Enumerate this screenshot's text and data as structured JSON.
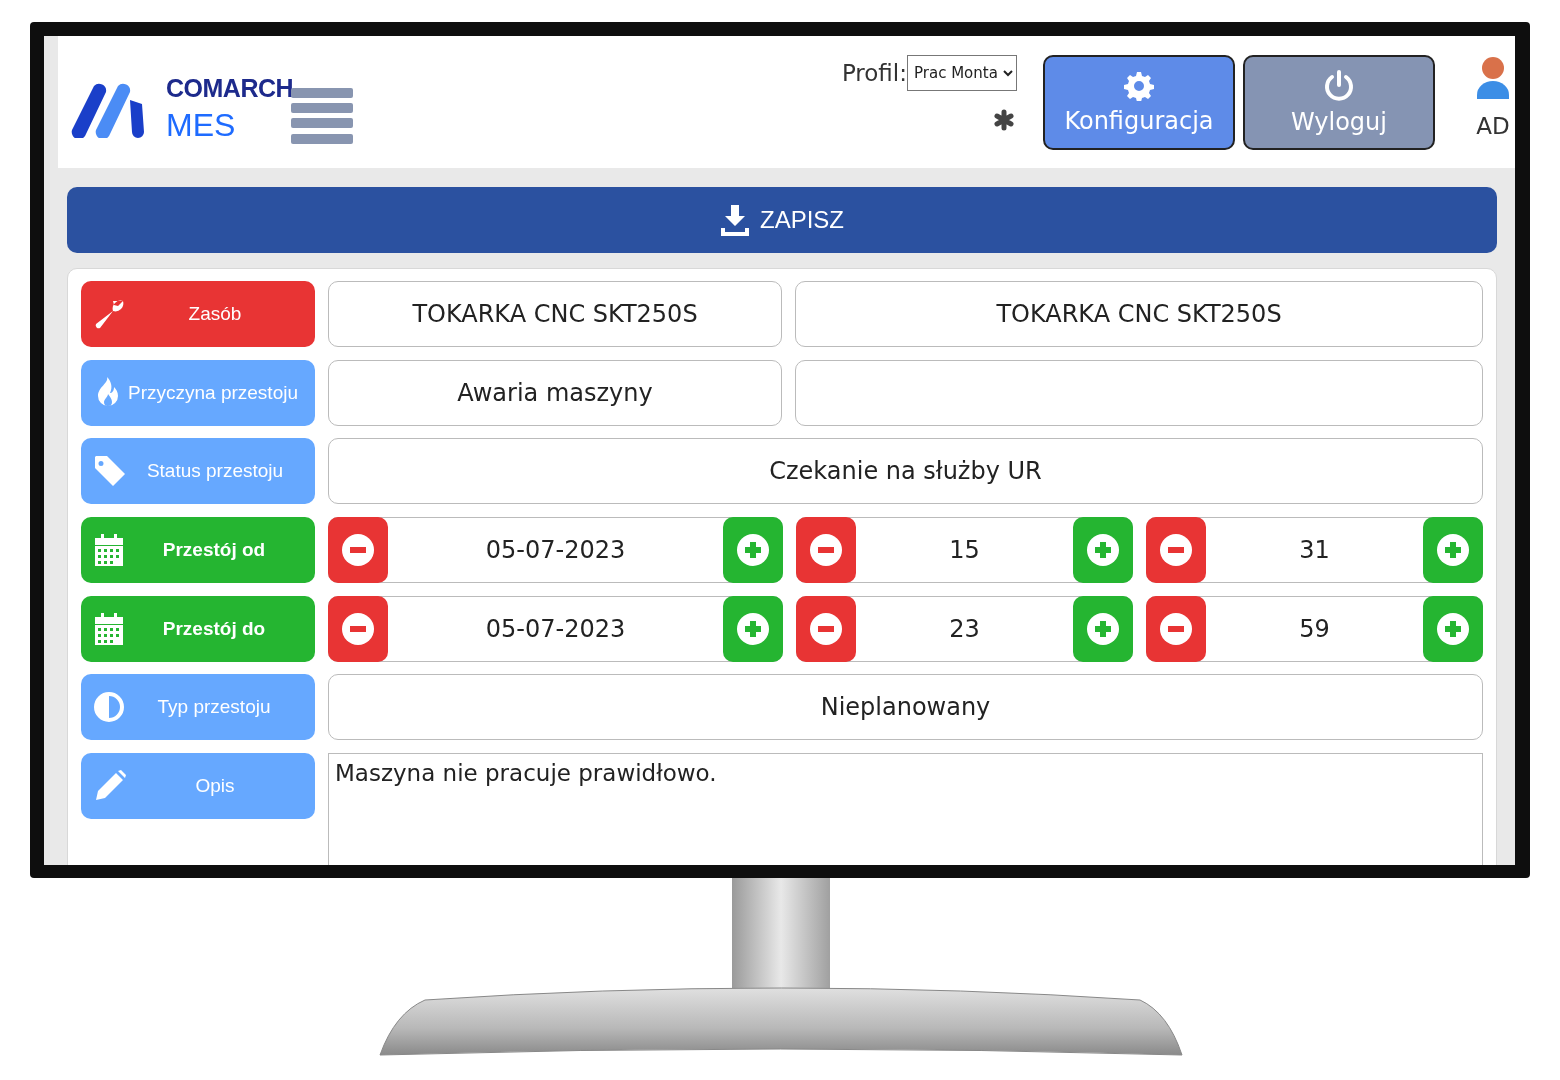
{
  "header": {
    "logo": {
      "line_1": "COMARCH",
      "line_2": "MES"
    },
    "profile_label": "Profil:",
    "profile_select": "Prac Monta",
    "buttons": [
      {
        "label": "Konfiguracja",
        "kind": "config"
      },
      {
        "label": "Wyloguj",
        "kind": "logout"
      }
    ],
    "user": "AD"
  },
  "save_button": "ZAPISZ",
  "rows": [
    {
      "kind": "pair",
      "label": "Zasób",
      "color": "#e83434",
      "values": [
        "TOKARKA CNC SKT250S",
        "TOKARKA CNC SKT250S"
      ]
    },
    {
      "kind": "pair",
      "label": "Przyczyna przestoju",
      "color": "#66a8ff",
      "values": [
        "Awaria maszyny"
      ]
    },
    {
      "kind": "single",
      "label": "Status przestoju",
      "color": "#66a8ff",
      "value": "Czekanie na służby UR"
    },
    {
      "kind": "stepper",
      "label": "Przestój od",
      "color": "#25b531",
      "steppers": [
        "05-07-2023",
        "15",
        "31"
      ]
    },
    {
      "kind": "stepper",
      "label": "Przestój do",
      "color": "#25b531",
      "steppers": [
        "05-07-2023",
        "23",
        "59"
      ]
    },
    {
      "kind": "single",
      "label": "Typ przestoju",
      "color": "#66a8ff",
      "value": "Nieplanowany"
    },
    {
      "kind": "text",
      "label": "Opis",
      "color": "#66a8ff",
      "value": "Maszyna nie pracuje prawidłowo."
    }
  ]
}
